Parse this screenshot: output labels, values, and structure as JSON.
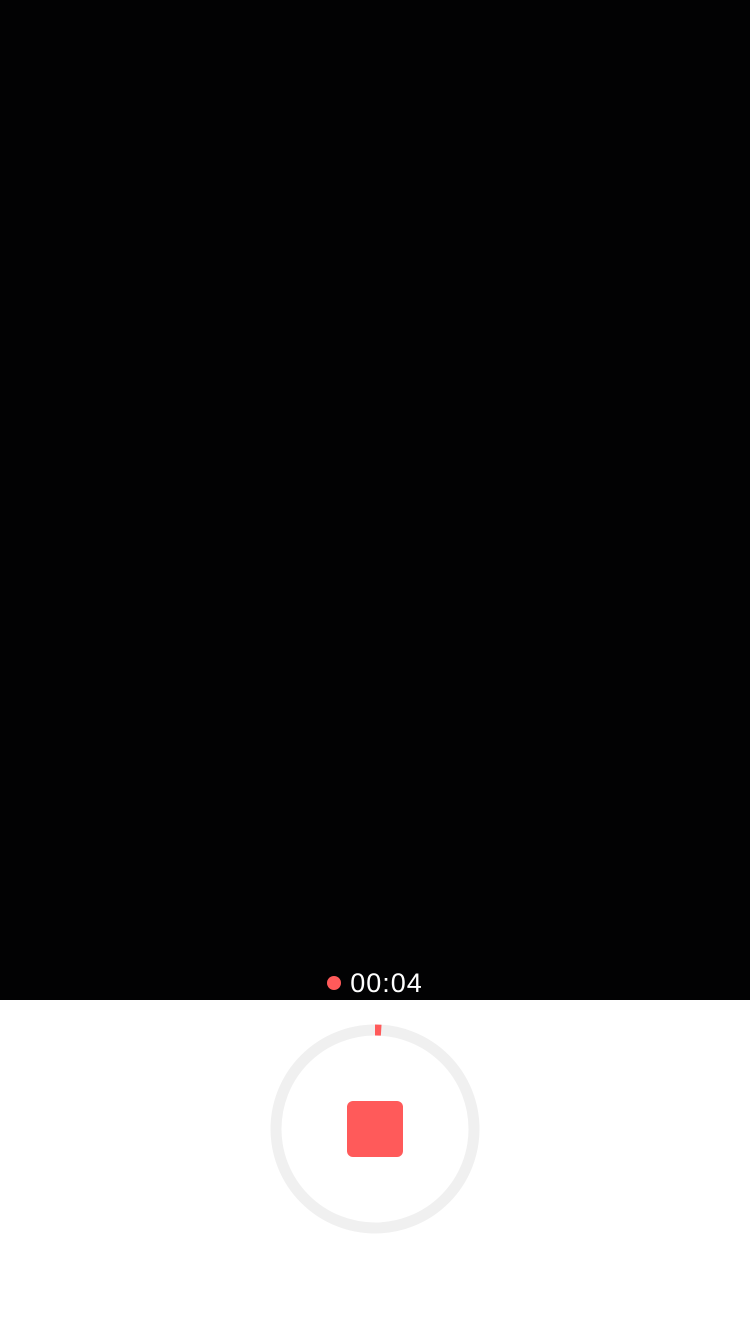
{
  "recording": {
    "elapsed": "00:04",
    "progress_fraction": 0.01
  },
  "colors": {
    "accent": "#ff5a5a",
    "ring_track": "#f0f0f0",
    "viewfinder": "#020203"
  },
  "icons": {
    "rec_dot": "recording-dot-icon",
    "stop": "stop-icon"
  }
}
